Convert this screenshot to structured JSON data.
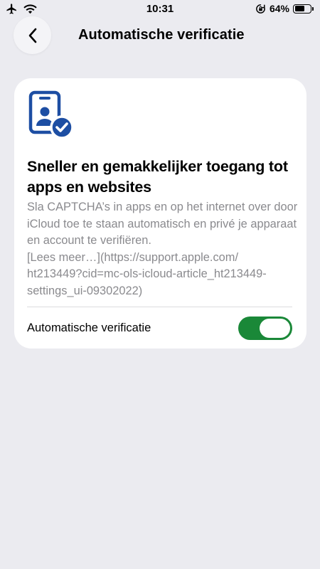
{
  "status_bar": {
    "time": "10:31",
    "battery_percent": "64%",
    "battery_level": 0.64,
    "icons": [
      "airplane-icon",
      "wifi-icon",
      "orientation-lock-icon",
      "battery-icon"
    ]
  },
  "nav": {
    "title": "Automatische verificatie",
    "back_icon": "chevron-left-icon"
  },
  "card": {
    "icon": "id-card-check-icon",
    "heading": "Sneller en gemakkelijker toegang tot apps en websites",
    "description": "Sla CAPTCHA’s in apps en op het internet over door iCloud toe te staan automatisch en privé je apparaat en account te verifiëren.\n[Lees meer…](https://support.apple.com/\nht213449?cid=mc-ols-icloud-article_ht213449-\nsettings_ui-09302022)",
    "toggle": {
      "label": "Automatische verificatie",
      "on": true
    }
  },
  "colors": {
    "background": "#ebebf0",
    "card": "#ffffff",
    "accent_blue": "#1d4ea3",
    "toggle_green": "#1a8838",
    "secondary_text": "#8a8a8e"
  }
}
